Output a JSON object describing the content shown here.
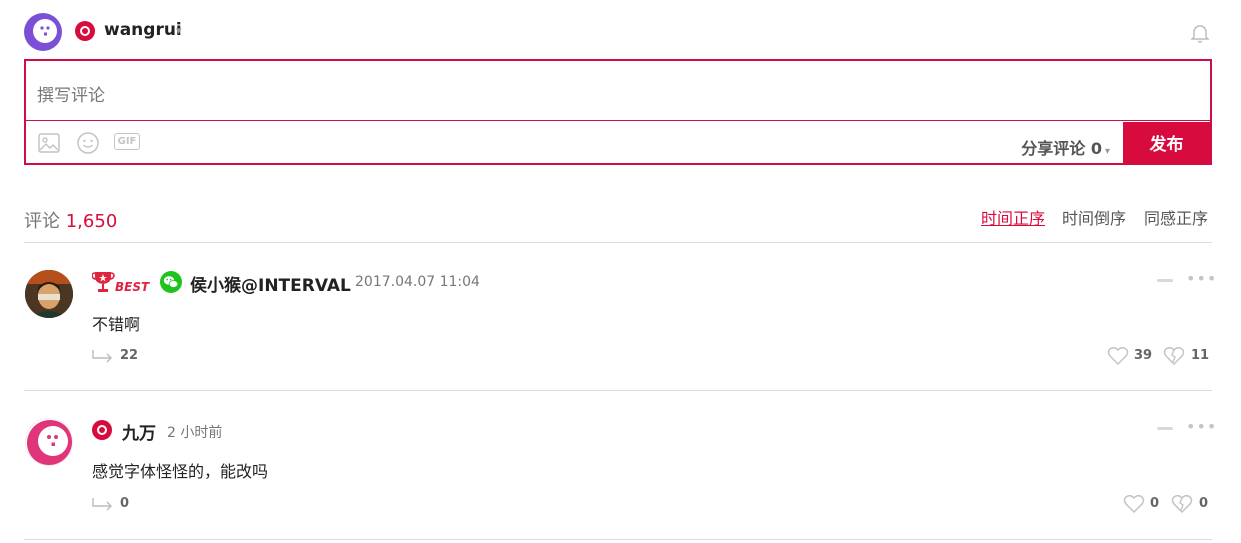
{
  "user": {
    "name": "wangrui",
    "caret": "▾"
  },
  "editor": {
    "placeholder": "撰写评论",
    "tools": [
      "image-icon",
      "emoji-icon",
      "gif-icon"
    ],
    "gif_label": "GIF",
    "share_label": "分享评论",
    "share_count": "0",
    "share_caret": "▾",
    "publish_label": "发布"
  },
  "comments_header": {
    "label": "评论",
    "count": "1,650",
    "sort_options": [
      "时间正序",
      "时间倒序",
      "同感正序"
    ],
    "active_sort": "时间正序"
  },
  "comments": [
    {
      "badge": "BEST",
      "source_icon": "wechat-icon",
      "username": "侯小猴@INTERVAL",
      "time": "2017.04.07 11:04",
      "text": "不错啊",
      "replies": "22",
      "likes": "39",
      "dislikes": "11"
    },
    {
      "source_icon": "brand-logo-icon",
      "username": "九万",
      "time": "2 小时前",
      "text": "感觉字体怪怪的，能改吗",
      "replies": "0",
      "likes": "0",
      "dislikes": "0"
    }
  ],
  "colors": {
    "accent": "#d80b3e",
    "rule": "#dcdcdc",
    "muted": "#777777"
  }
}
